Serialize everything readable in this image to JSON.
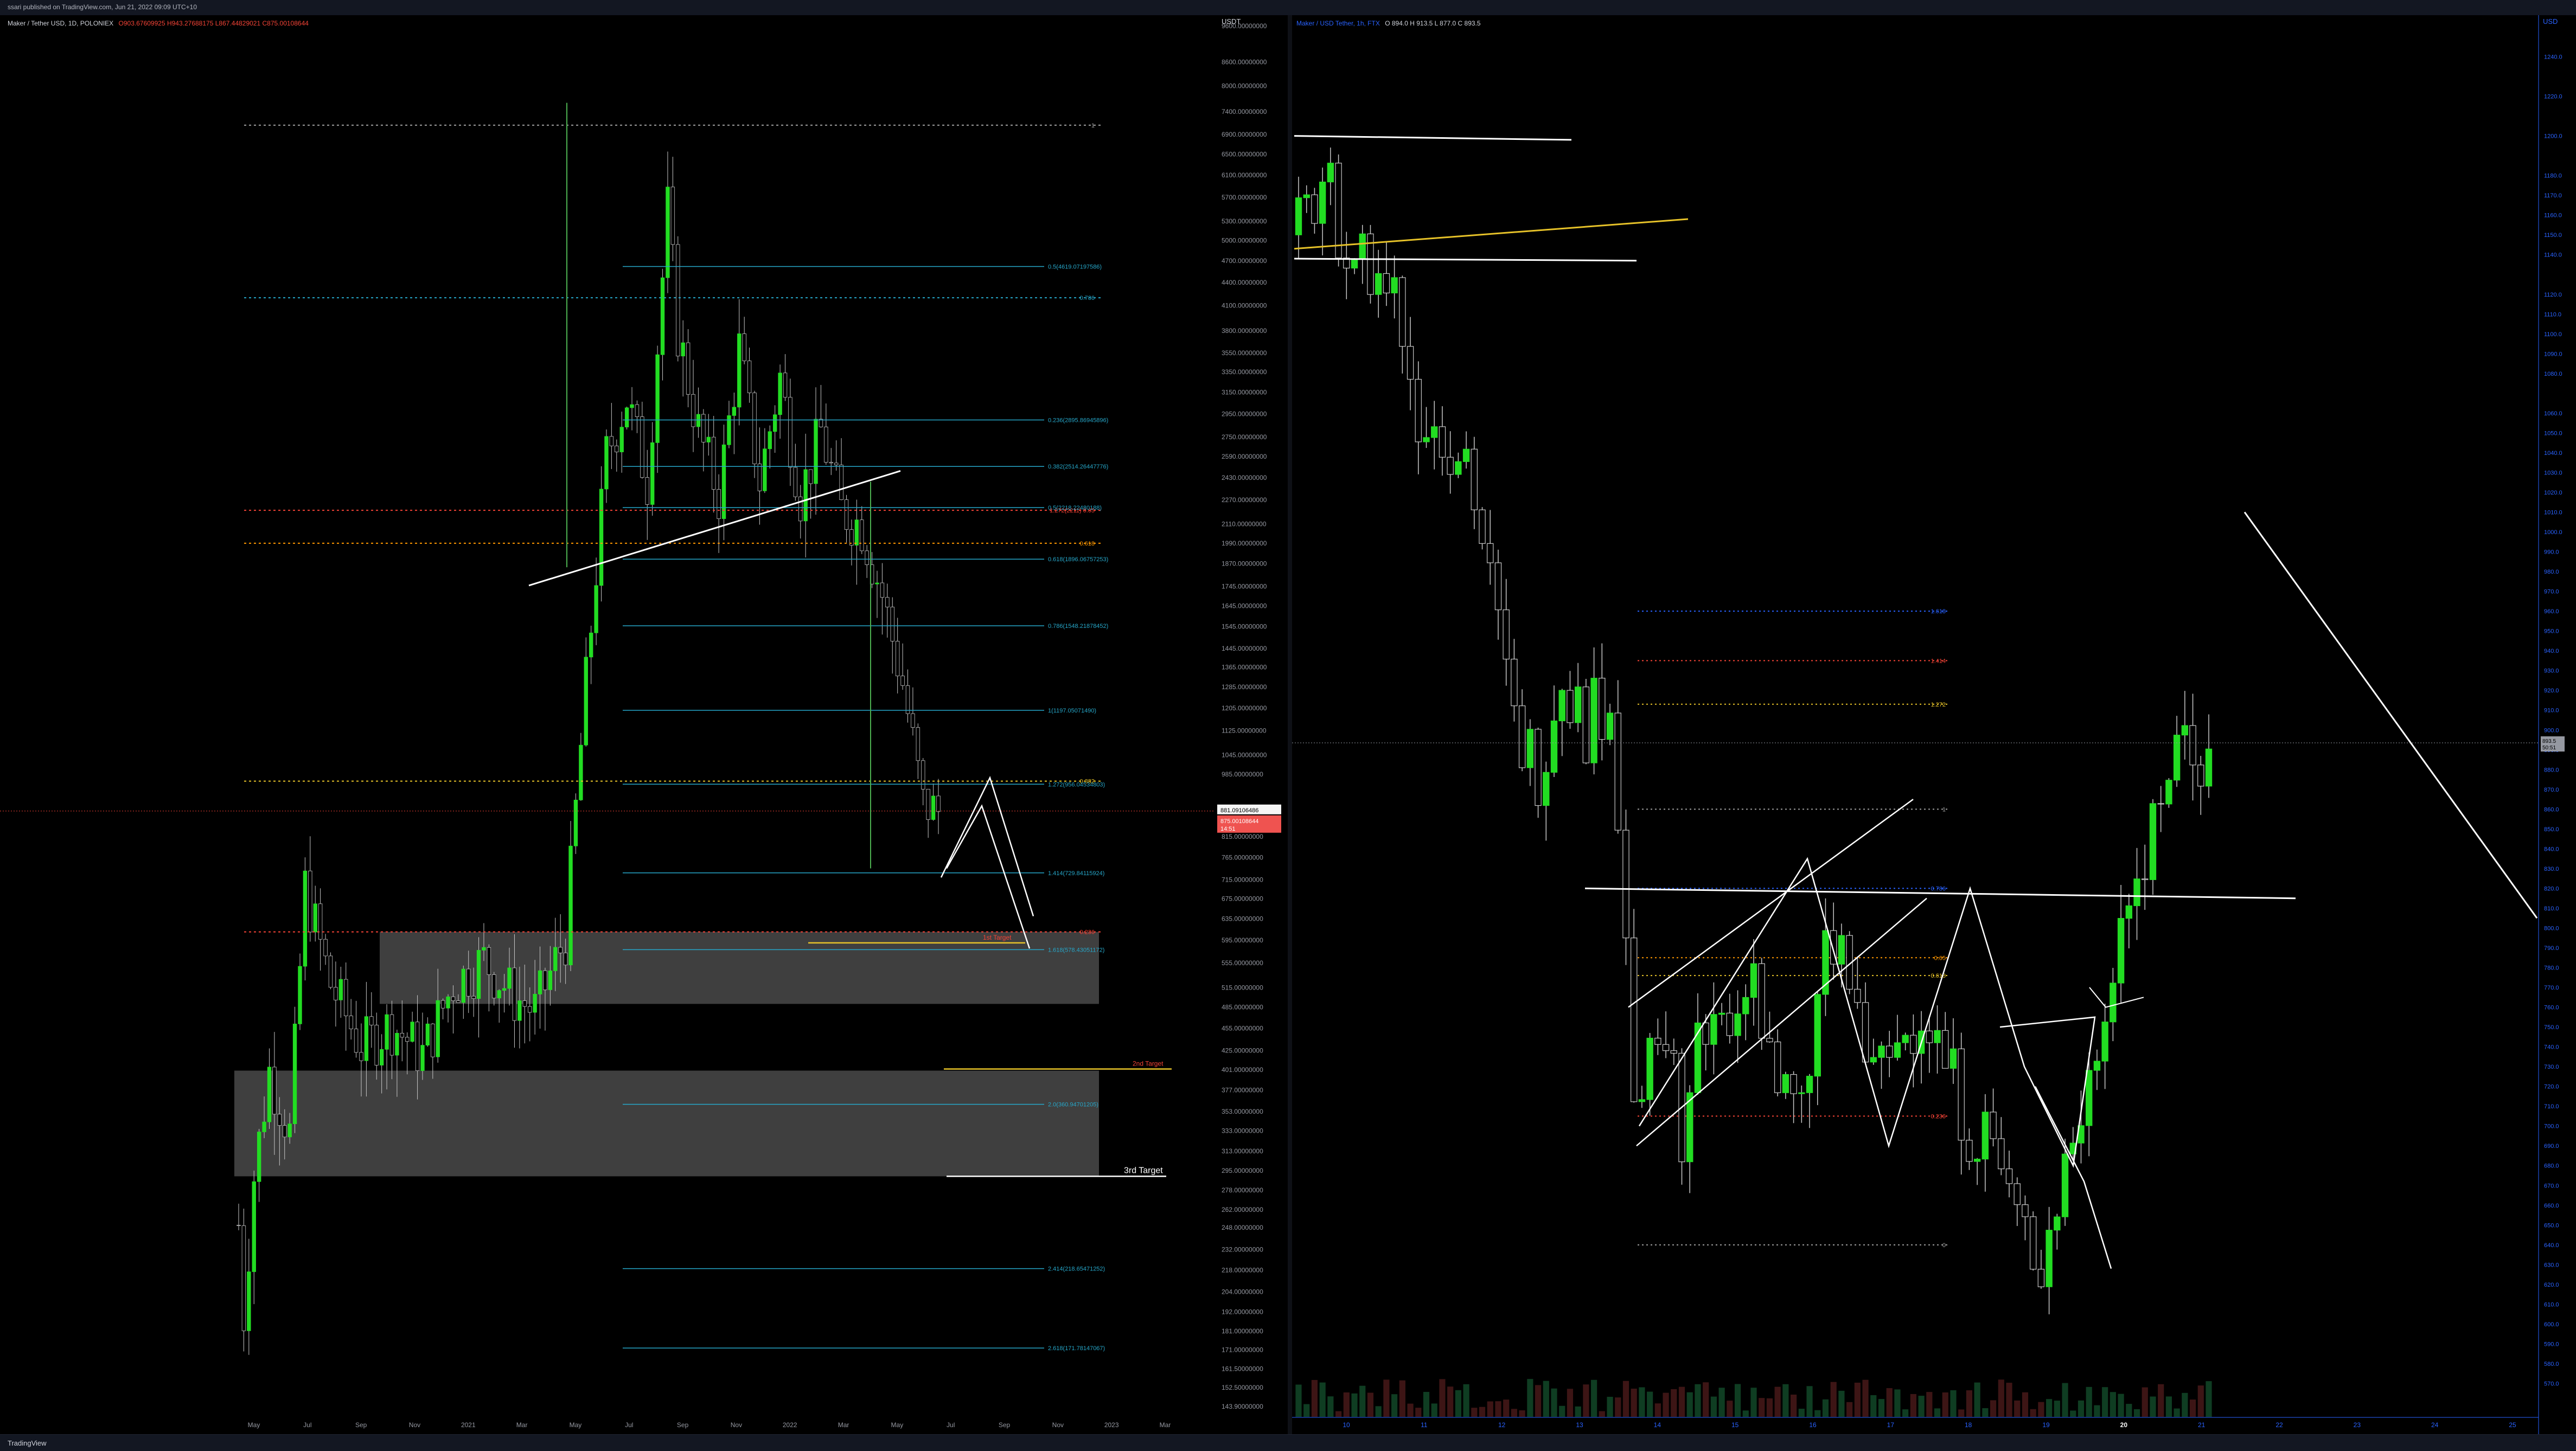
{
  "header": {
    "published_by": "ssari published on TradingView.com, Jun 21, 2022 09:09 UTC+10"
  },
  "footer": {
    "brand": "TradingView"
  },
  "colors": {
    "up": "#22dd22",
    "down": "#000000",
    "wick": "#c8c8c8",
    "fib": "#26a6c8",
    "bg": "#000000"
  },
  "chart_data": [
    {
      "type": "candlestick",
      "symbol_legend": "Maker / Tether USD, 1D, POLONIEX",
      "ohlc_readout": [
        "O903.67609925",
        "H943.27688175",
        "L867.44829021",
        "C875.00108644"
      ],
      "price_axis_label": "USDT",
      "y_scale": "log",
      "ylim": [
        143,
        9600
      ],
      "y_ticks": [
        "9600.00000000",
        "8600.00000000",
        "8000.00000000",
        "7400.00000000",
        "6900.00000000",
        "6500.00000000",
        "6100.00000000",
        "5700.00000000",
        "5300.00000000",
        "5000.00000000",
        "4700.00000000",
        "4400.00000000",
        "4100.00000000",
        "3800.00000000",
        "3550.00000000",
        "3350.00000000",
        "3150.00000000",
        "2950.00000000",
        "2750.00000000",
        "2590.00000000",
        "2430.00000000",
        "2270.00000000",
        "2110.00000000",
        "1990.00000000",
        "1870.00000000",
        "1745.00000000",
        "1645.00000000",
        "1545.00000000",
        "1445.00000000",
        "1365.00000000",
        "1285.00000000",
        "1205.00000000",
        "1125.00000000",
        "1045.00000000",
        "985.00000000",
        "815.00000000",
        "765.00000000",
        "715.00000000",
        "675.00000000",
        "635.00000000",
        "595.00000000",
        "555.00000000",
        "515.00000000",
        "485.00000000",
        "455.00000000",
        "425.00000000",
        "401.00000000",
        "377.00000000",
        "353.00000000",
        "333.00000000",
        "313.00000000",
        "295.00000000",
        "278.00000000",
        "262.00000000",
        "248.00000000",
        "232.00000000",
        "218.00000000",
        "204.00000000",
        "192.00000000",
        "181.00000000",
        "171.00000000",
        "161.50000000",
        "152.50000000",
        "143.90000000"
      ],
      "x_ticks": [
        "May",
        "Jul",
        "Sep",
        "Nov",
        "2021",
        "Mar",
        "May",
        "Jul",
        "Sep",
        "Nov",
        "2022",
        "Mar",
        "May",
        "Jul",
        "Sep",
        "Nov",
        "2023",
        "Mar"
      ],
      "price_marker": {
        "price": "881.09106486",
        "last": "875.00108644",
        "countdown": "14:51"
      },
      "fib_levels": [
        {
          "label": "0.5(4619.07197586)",
          "price": 4619
        },
        {
          "label": "0.236(2895.86945896)",
          "price": 2896
        },
        {
          "label": "0.382(2514.26447776)",
          "price": 2514
        },
        {
          "label": "0.5(2218.22480188)",
          "price": 2218
        },
        {
          "label": "0.618(1896.06757253)",
          "price": 1896
        },
        {
          "label": "0.786(1548.21878452)",
          "price": 1548
        },
        {
          "label": "1(1197.05071490)",
          "price": 1197
        },
        {
          "label": "1.272(956.04534803)",
          "price": 956
        },
        {
          "label": "1.414(729.84115924)",
          "price": 730
        },
        {
          "label": "1.618(578.43051172)",
          "price": 578
        },
        {
          "label": "2.0(360.94701205)",
          "price": 361
        },
        {
          "label": "2.414(218.65471252)",
          "price": 219
        },
        {
          "label": "2.618(171.78147067)",
          "price": 172
        }
      ],
      "horizontal_levels": [
        {
          "label": "1",
          "price": 7100,
          "color": "#9e9e9e"
        },
        {
          "label": "0.786",
          "price": 4200,
          "color": "#26a6c8"
        },
        {
          "label": "1.272(2211) 0.65",
          "price": 2200,
          "color": "#f44336"
        },
        {
          "label": "0.618",
          "price": 1990,
          "color": "#ff9800"
        },
        {
          "label": "0.382",
          "price": 965,
          "color": "#e6c229"
        },
        {
          "label": "0.236",
          "price": 610,
          "color": "#f44336"
        }
      ],
      "targets": [
        "1st Target",
        "2nd Target",
        "3rd Target"
      ],
      "supply_demand_zones": [
        {
          "from": 490,
          "to": 610
        },
        {
          "from": 290,
          "to": 400
        }
      ]
    },
    {
      "type": "candlestick",
      "symbol_legend": "Maker / USD Tether, 1h, FTX",
      "ohlc_readout": [
        "O 894.0",
        "H 913.5",
        "L 877.0",
        "C 893.5"
      ],
      "price_axis_label": "USD",
      "ylim": [
        560,
        1250
      ],
      "y_ticks": [
        "1240.0",
        "1220.0",
        "1200.0",
        "1180.0",
        "1170.0",
        "1160.0",
        "1150.0",
        "1140.0",
        "1120.0",
        "1110.0",
        "1100.0",
        "1090.0",
        "1080.0",
        "1060.0",
        "1050.0",
        "1040.0",
        "1030.0",
        "1020.0",
        "1010.0",
        "1000.0",
        "990.0",
        "980.0",
        "970.0",
        "960.0",
        "950.0",
        "940.0",
        "930.0",
        "920.0",
        "910.0",
        "900.0",
        "890.0",
        "880.0",
        "870.0",
        "860.0",
        "850.0",
        "840.0",
        "830.0",
        "820.0",
        "810.0",
        "800.0",
        "790.0",
        "780.0",
        "770.0",
        "760.0",
        "750.0",
        "740.0",
        "730.0",
        "720.0",
        "710.0",
        "700.0",
        "690.0",
        "680.0",
        "670.0",
        "660.0",
        "650.0",
        "640.0",
        "630.0",
        "620.0",
        "610.0",
        "600.0",
        "590.0",
        "580.0",
        "570.0"
      ],
      "x_ticks": [
        "10",
        "11",
        "12",
        "13",
        "14",
        "15",
        "16",
        "17",
        "18",
        "19",
        "20",
        "21",
        "22",
        "23",
        "24",
        "25"
      ],
      "price_marker": {
        "price": "893.5",
        "countdown": "50:51"
      },
      "fib_levels": [
        {
          "label": "1.618",
          "price": 960,
          "color": "#2962ff"
        },
        {
          "label": "1.414",
          "price": 935,
          "color": "#f44336"
        },
        {
          "label": "1.272",
          "price": 913,
          "color": "#e6c229"
        },
        {
          "label": "1",
          "price": 860,
          "color": "#9e9e9e"
        },
        {
          "label": "0.786",
          "price": 820,
          "color": "#2962ff"
        },
        {
          "label": "0.65",
          "price": 785,
          "color": "#ff9800"
        },
        {
          "label": "0.618",
          "price": 776,
          "color": "#e6c229"
        },
        {
          "label": "0.236",
          "price": 705,
          "color": "#f44336"
        },
        {
          "label": "0",
          "price": 640,
          "color": "#9e9e9e"
        }
      ]
    }
  ]
}
